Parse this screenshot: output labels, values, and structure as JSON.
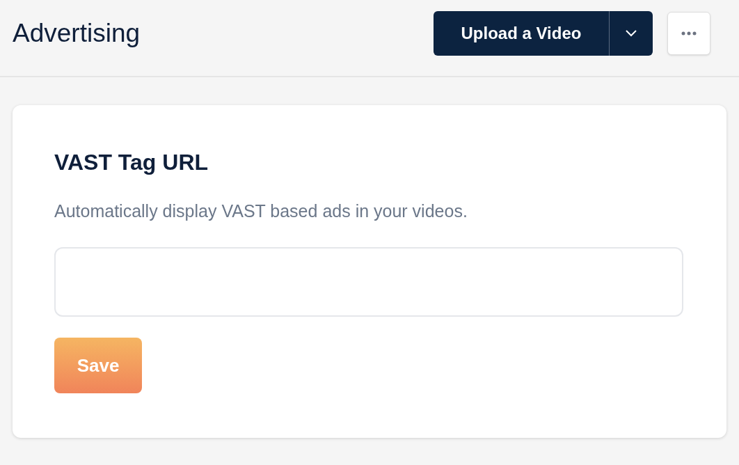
{
  "header": {
    "title": "Advertising",
    "upload_button": {
      "label": "Upload a Video"
    }
  },
  "card": {
    "title": "VAST Tag URL",
    "description": "Automatically display VAST based ads in your videos.",
    "save_button": {
      "label": "Save"
    }
  }
}
